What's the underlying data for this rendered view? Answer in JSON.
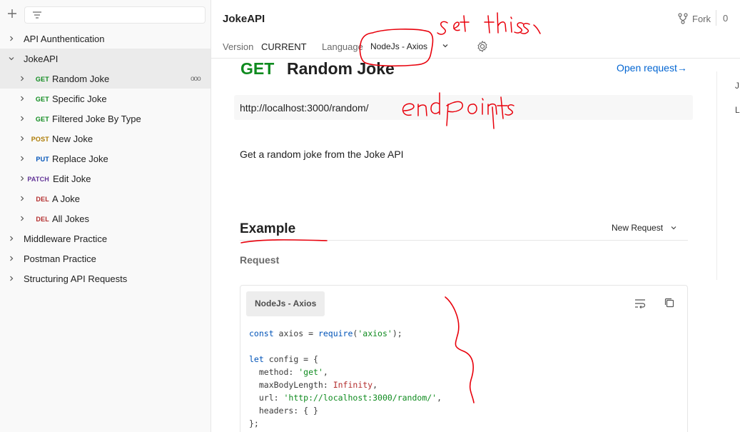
{
  "sidebar": {
    "items": [
      {
        "type": "folder",
        "label": "API Aunthentication",
        "expanded": false
      },
      {
        "type": "folder",
        "label": "JokeAPI",
        "expanded": true
      },
      {
        "type": "request",
        "method": "GET",
        "label": "Random Joke",
        "active": true
      },
      {
        "type": "request",
        "method": "GET",
        "label": "Specific Joke"
      },
      {
        "type": "request",
        "method": "GET",
        "label": "Filtered Joke By Type"
      },
      {
        "type": "request",
        "method": "POST",
        "label": "New Joke"
      },
      {
        "type": "request",
        "method": "PUT",
        "label": "Replace Joke"
      },
      {
        "type": "request",
        "method": "PATCH",
        "label": "Edit Joke"
      },
      {
        "type": "request",
        "method": "DEL",
        "label": "A Joke"
      },
      {
        "type": "request",
        "method": "DEL",
        "label": "All Jokes"
      },
      {
        "type": "folder",
        "label": "Middleware Practice",
        "expanded": false
      },
      {
        "type": "folder",
        "label": "Postman Practice",
        "expanded": false
      },
      {
        "type": "folder",
        "label": "Structuring API Requests",
        "expanded": false
      }
    ],
    "active_more": "ooo"
  },
  "header": {
    "collection_title": "JokeAPI",
    "fork_label": "Fork",
    "fork_count": "0",
    "version_label": "Version",
    "version_value": "CURRENT",
    "language_label": "Language",
    "language_value": "NodeJs - Axios"
  },
  "request": {
    "method": "GET",
    "title": "Random Joke",
    "open_request": "Open request→",
    "url": "http://localhost:3000/random/",
    "description": "Get a random joke from the Joke API"
  },
  "example": {
    "heading": "Example",
    "new_request_label": "New Request",
    "request_label": "Request",
    "code_language": "NodeJs - Axios",
    "code_lines": [
      [
        [
          "k",
          "const"
        ],
        [
          "p",
          " axios = "
        ],
        [
          "k",
          "require"
        ],
        [
          "p",
          "("
        ],
        [
          "s",
          "'axios'"
        ],
        [
          "p",
          ");"
        ]
      ],
      [],
      [
        [
          "k",
          "let"
        ],
        [
          "p",
          " config = {"
        ]
      ],
      [
        [
          "p",
          "  method: "
        ],
        [
          "s",
          "'get'"
        ],
        [
          "p",
          ","
        ]
      ],
      [
        [
          "p",
          "  maxBodyLength: "
        ],
        [
          "n",
          "Infinity"
        ],
        [
          "p",
          ","
        ]
      ],
      [
        [
          "p",
          "  url: "
        ],
        [
          "s",
          "'http://localhost:3000/random/'"
        ],
        [
          "p",
          ","
        ]
      ],
      [
        [
          "p",
          "  headers: { }"
        ]
      ],
      [
        [
          "p",
          "};"
        ]
      ]
    ]
  },
  "right_panel_glyphs": [
    "J",
    "L"
  ],
  "annotations": {
    "note_set_this": "set this",
    "note_endpoints": "endpoints"
  },
  "colors": {
    "get": "#0f8b1f",
    "post": "#ad7a03",
    "put": "#0053b8",
    "patch": "#623497",
    "del": "#b32d2d",
    "link": "#0265d2",
    "annotation": "#e8000b",
    "accent": "#f26b3a"
  }
}
